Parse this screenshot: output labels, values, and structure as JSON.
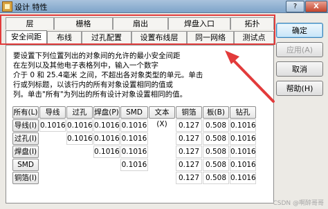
{
  "window": {
    "title": "设计 特性",
    "help_symbol": "?",
    "close_symbol": "X"
  },
  "tabs_row1": [
    "层",
    "栅格",
    "扇出",
    "焊盘入口",
    "拓扑"
  ],
  "tabs_row2": [
    "安全间距",
    "布线",
    "过孔配置",
    "设置布线层",
    "同一网络",
    "测试点"
  ],
  "active_tab": "安全间距",
  "description": "要设置下列位置列出的对象间的允许的最小安全间距\n在左列以及其他电子表格列中，输入一个数字\n介于 0 和 25.4毫米 之间，不超出各对象类型的单元。单击\n行或列标题，以该行内的所有对象设置相同的值或\n列。单击\"所有\"为列出的所有设计对象设置相同的值。",
  "grid": {
    "columns": [
      "所有(L)",
      "导线(C)",
      "过孔(V)",
      "焊盘(P)",
      "SMD (S)",
      "文本(X)",
      "铜箔(O)",
      "板(B)",
      "钻孔(R)"
    ],
    "rows": [
      {
        "label": "导线(I)",
        "values": [
          "0.1016",
          "0.1016",
          "0.1016",
          "0.1016",
          "",
          "0.127",
          "0.508",
          "0.1016"
        ]
      },
      {
        "label": "过孔(I)",
        "values": [
          "",
          "0.1016",
          "0.1016",
          "0.1016",
          "",
          "0.127",
          "0.508",
          "0.1016"
        ]
      },
      {
        "label": "焊盘(I)",
        "values": [
          "",
          "",
          "0.1016",
          "0.1016",
          "",
          "0.127",
          "0.508",
          "0.1016"
        ]
      },
      {
        "label": "SMD",
        "values": [
          "",
          "",
          "",
          "0.1016",
          "",
          "0.127",
          "0.508",
          "0.1016"
        ]
      },
      {
        "label": "铜箔(I)",
        "values": [
          "",
          "",
          "",
          "",
          "",
          "0.127",
          "0.508",
          "0.1016"
        ]
      }
    ]
  },
  "buttons": {
    "ok": "确定",
    "apply": "应用(A)",
    "cancel": "取消",
    "help": "帮助(H)"
  },
  "colors": {
    "highlight": "#e23b3b",
    "arrow": "#e23b3b"
  },
  "watermark": "CSDN @啊醉哥哥"
}
